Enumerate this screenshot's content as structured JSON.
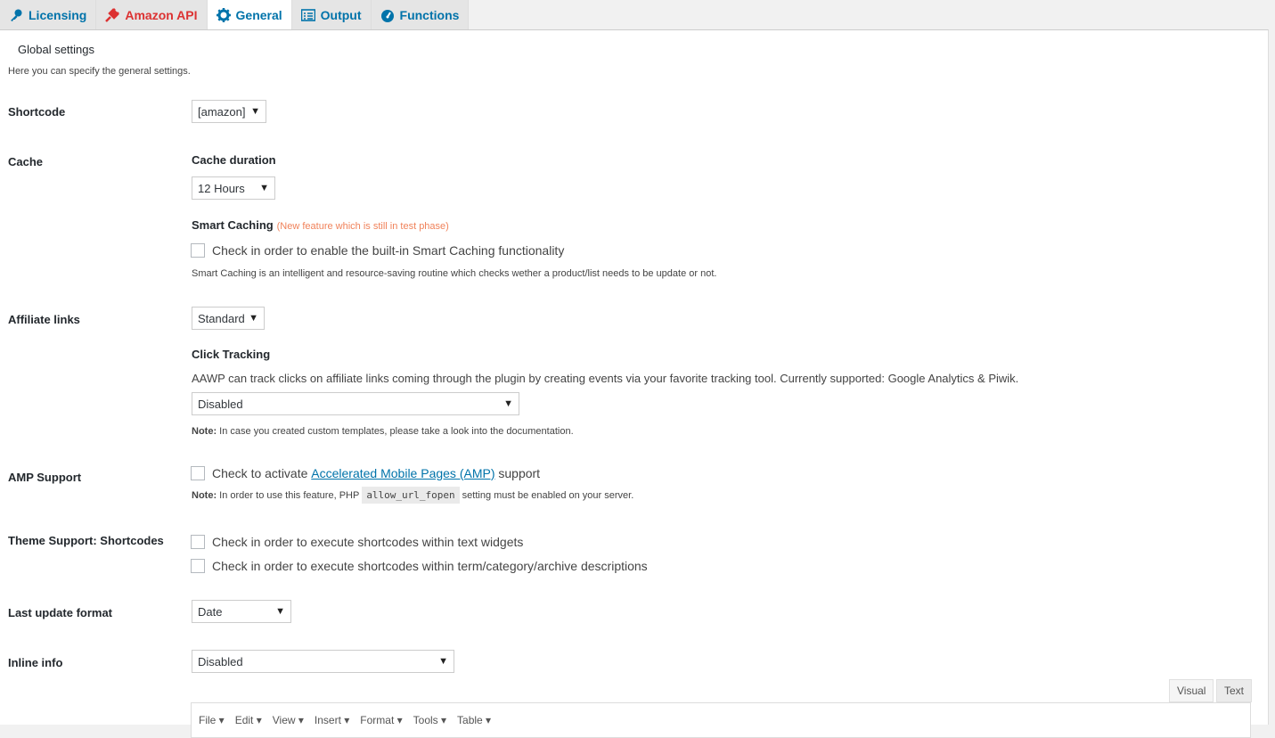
{
  "tabs": [
    {
      "label": "Licensing",
      "icon": "key-icon"
    },
    {
      "label": "Amazon API",
      "icon": "plug-icon"
    },
    {
      "label": "General",
      "icon": "gear-icon",
      "active": true
    },
    {
      "label": "Output",
      "icon": "list-icon"
    },
    {
      "label": "Functions",
      "icon": "dashboard-icon"
    }
  ],
  "section_title": "Global settings",
  "intro": "Here you can specify the general settings.",
  "shortcode": {
    "label": "Shortcode",
    "value": "[amazon]"
  },
  "cache": {
    "label": "Cache",
    "duration_label": "Cache duration",
    "duration_value": "12 Hours",
    "smart_label": "Smart Caching",
    "smart_note": "(New feature which is still in test phase)",
    "smart_checkbox": "Check in order to enable the built-in Smart Caching functionality",
    "smart_desc": "Smart Caching is an intelligent and resource-saving routine which checks wether a product/list needs to be update or not."
  },
  "affiliate": {
    "label": "Affiliate links",
    "value": "Standard",
    "click_label": "Click Tracking",
    "click_desc": "AAWP can track clicks on affiliate links coming through the plugin by creating events via your favorite tracking tool. Currently supported: Google Analytics & Piwik.",
    "click_value": "Disabled",
    "note_prefix": "Note:",
    "note": "In case you created custom templates, please take a look into the documentation."
  },
  "amp": {
    "label": "AMP Support",
    "check_prefix": "Check to activate",
    "link": "Accelerated Mobile Pages (AMP)",
    "check_suffix": "support",
    "note_prefix": "Note:",
    "note_a": "In order to use this feature, PHP",
    "code": "allow_url_fopen",
    "note_b": "setting must be enabled on your server."
  },
  "theme": {
    "label": "Theme Support: Shortcodes",
    "check1": "Check in order to execute shortcodes within text widgets",
    "check2": "Check in order to execute shortcodes within term/category/archive descriptions"
  },
  "last_update": {
    "label": "Last update format",
    "value": "Date"
  },
  "inline": {
    "label": "Inline info",
    "value": "Disabled"
  },
  "editor": {
    "visual": "Visual",
    "text": "Text",
    "menu": [
      "File",
      "Edit",
      "View",
      "Insert",
      "Format",
      "Tools",
      "Table"
    ]
  }
}
